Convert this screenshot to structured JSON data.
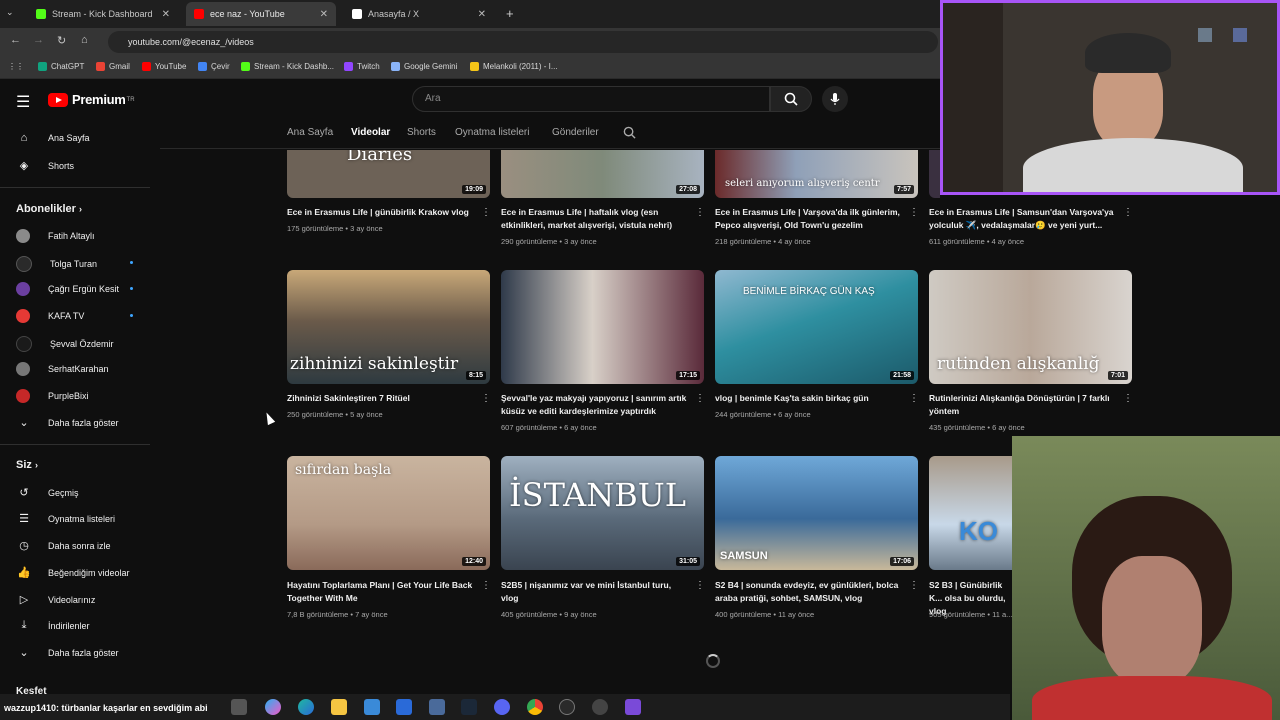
{
  "browser": {
    "tabs": [
      {
        "label": "Stream - Kick Dashboard",
        "color": "#53fc18"
      },
      {
        "label": "ece naz - YouTube",
        "color": "#ff0000"
      },
      {
        "label": "Anasayfa / X",
        "color": "#ffffff"
      }
    ],
    "url": "youtube.com/@ecenaz_/videos",
    "bookmarks": [
      {
        "label": "ChatGPT",
        "color": "#10a37f"
      },
      {
        "label": "Gmail",
        "color": "#ea4335"
      },
      {
        "label": "YouTube",
        "color": "#ff0000"
      },
      {
        "label": "Çevir",
        "color": "#4285f4"
      },
      {
        "label": "Stream - Kick Dashb...",
        "color": "#53fc18"
      },
      {
        "label": "Twitch",
        "color": "#9146ff"
      },
      {
        "label": "Google Gemini",
        "color": "#8ab4f8"
      },
      {
        "label": "Melankoli (2011) - I...",
        "color": "#f5c518"
      }
    ]
  },
  "header": {
    "logo": "Premium",
    "logo_sup": "TR",
    "search_placeholder": "Ara"
  },
  "sidebar": {
    "top": [
      "Ana Sayfa",
      "Shorts"
    ],
    "subscriptions_title": "Abonelikler",
    "subscriptions": [
      {
        "label": "Fatih Altaylı",
        "color": "#8a8a8a",
        "dot": false
      },
      {
        "label": "Tolga Turan",
        "color": "#2a2a2a",
        "dot": true
      },
      {
        "label": "Çağrı Ergün Kesit",
        "color": "#6b3fa0",
        "dot": true
      },
      {
        "label": "KAFA TV",
        "color": "#e53935",
        "dot": true
      },
      {
        "label": "Şevval Özdemir",
        "color": "#1a1a1a",
        "dot": false
      },
      {
        "label": "SerhatKarahan",
        "color": "#777777",
        "dot": false
      },
      {
        "label": "PurpleBixi",
        "color": "#c62828",
        "dot": false
      },
      {
        "label": "Daha fazla göster",
        "color": "",
        "dot": false
      }
    ],
    "you_title": "Siz",
    "you_items": [
      "Geçmiş",
      "Oynatma listeleri",
      "Daha sonra izle",
      "Beğendiğim videolar",
      "Videolarınız",
      "İndirilenler",
      "Daha fazla göster"
    ],
    "explore_title": "Keşfet"
  },
  "channel_tabs": [
    "Ana Sayfa",
    "Videolar",
    "Shorts",
    "Oynatma listeleri",
    "Gönderiler"
  ],
  "videos": [
    {
      "title": "Ece in Erasmus Life | günübirlik Krakow vlog",
      "views": "175 görüntüleme",
      "age": "3 ay önce",
      "duration": "19:09",
      "overlay": "Diaries",
      "bg": "#6d6257"
    },
    {
      "title": "Ece in Erasmus Life | haftalık vlog (esn etkinlikleri, market alışverişi, vistula nehri)",
      "views": "290 görüntüleme",
      "age": "3 ay önce",
      "duration": "27:08",
      "overlay": "",
      "bg": "#8a8f80"
    },
    {
      "title": "Ece in Erasmus Life | Varşova'da ilk günlerim, Pepco alışverişi, Old Town'u gezelim",
      "views": "218 görüntüleme",
      "age": "4 ay önce",
      "duration": "7:57",
      "overlay": "seleri anıyorum alışveriş centr",
      "bg": "#7a8aa0"
    },
    {
      "title": "Ece in Erasmus Life | Samsun'dan Varşova'ya yolculuk ✈️, vedalaşmalar🥲 ve yeni yurt...",
      "views": "611 görüntüleme",
      "age": "4 ay önce",
      "duration": "",
      "overlay": "",
      "bg": "#3a3040"
    },
    {
      "title": "Zihninizi Sakinleştiren 7 Ritüel",
      "views": "250 görüntüleme",
      "age": "5 ay önce",
      "duration": "8:15",
      "overlay": "zihninizi sakinleştir",
      "bg": "#4a5560"
    },
    {
      "title": "Şevval'le yaz makyajı yapıyoruz | sanırım artık küsüz ve editi kardeşlerimize yaptırdık",
      "views": "607 görüntüleme",
      "age": "6 ay önce",
      "duration": "17:15",
      "overlay": "",
      "bg": "#5a4a40"
    },
    {
      "title": "vlog | benimle Kaş'ta sakin birkaç gün",
      "views": "244 görüntüleme",
      "age": "6 ay önce",
      "duration": "21:58",
      "overlay": "BENİMLE BİRKAÇ GÜN KAŞ",
      "bg": "#2e7d8f"
    },
    {
      "title": "Rutinlerinizi Alışkanlığa Dönüştürün | 7 farklı yöntem",
      "views": "435 görüntüleme",
      "age": "6 ay önce",
      "duration": "7:01",
      "overlay": "rutinden alışkanlığ",
      "bg": "#c9c4bd"
    },
    {
      "title": "Hayatını Toplarlama Planı | Get Your Life Back Together With Me",
      "views": "7,8 B görüntüleme",
      "age": "7 ay önce",
      "duration": "12:40",
      "overlay": "sıfırdan başla",
      "bg": "#b9a58f"
    },
    {
      "title": "S2B5 | nişanımız var ve mini İstanbul turu, vlog",
      "views": "405 görüntüleme",
      "age": "9 ay önce",
      "duration": "31:05",
      "overlay": "İSTANBUL",
      "bg": "#6a7a8a"
    },
    {
      "title": "S2 B4 | sonunda evdeyiz, ev günlükleri, bolca araba pratiği, sohbet, SAMSUN, vlog",
      "views": "400 görüntüleme",
      "age": "11 ay önce",
      "duration": "17:06",
      "overlay": "SAMSUN",
      "bg": "#4a7ab0"
    },
    {
      "title": "S2 B3 | Günübirlik K... olsa bu olurdu, vlog",
      "views": "905 görüntüleme",
      "age": "11 a...",
      "duration": "",
      "overlay": "KO",
      "bg": "#8a7a6a"
    }
  ],
  "taskbar": {
    "ticker": "wazzup1410: türbanlar kaşarlar en sevdiğim abi"
  }
}
